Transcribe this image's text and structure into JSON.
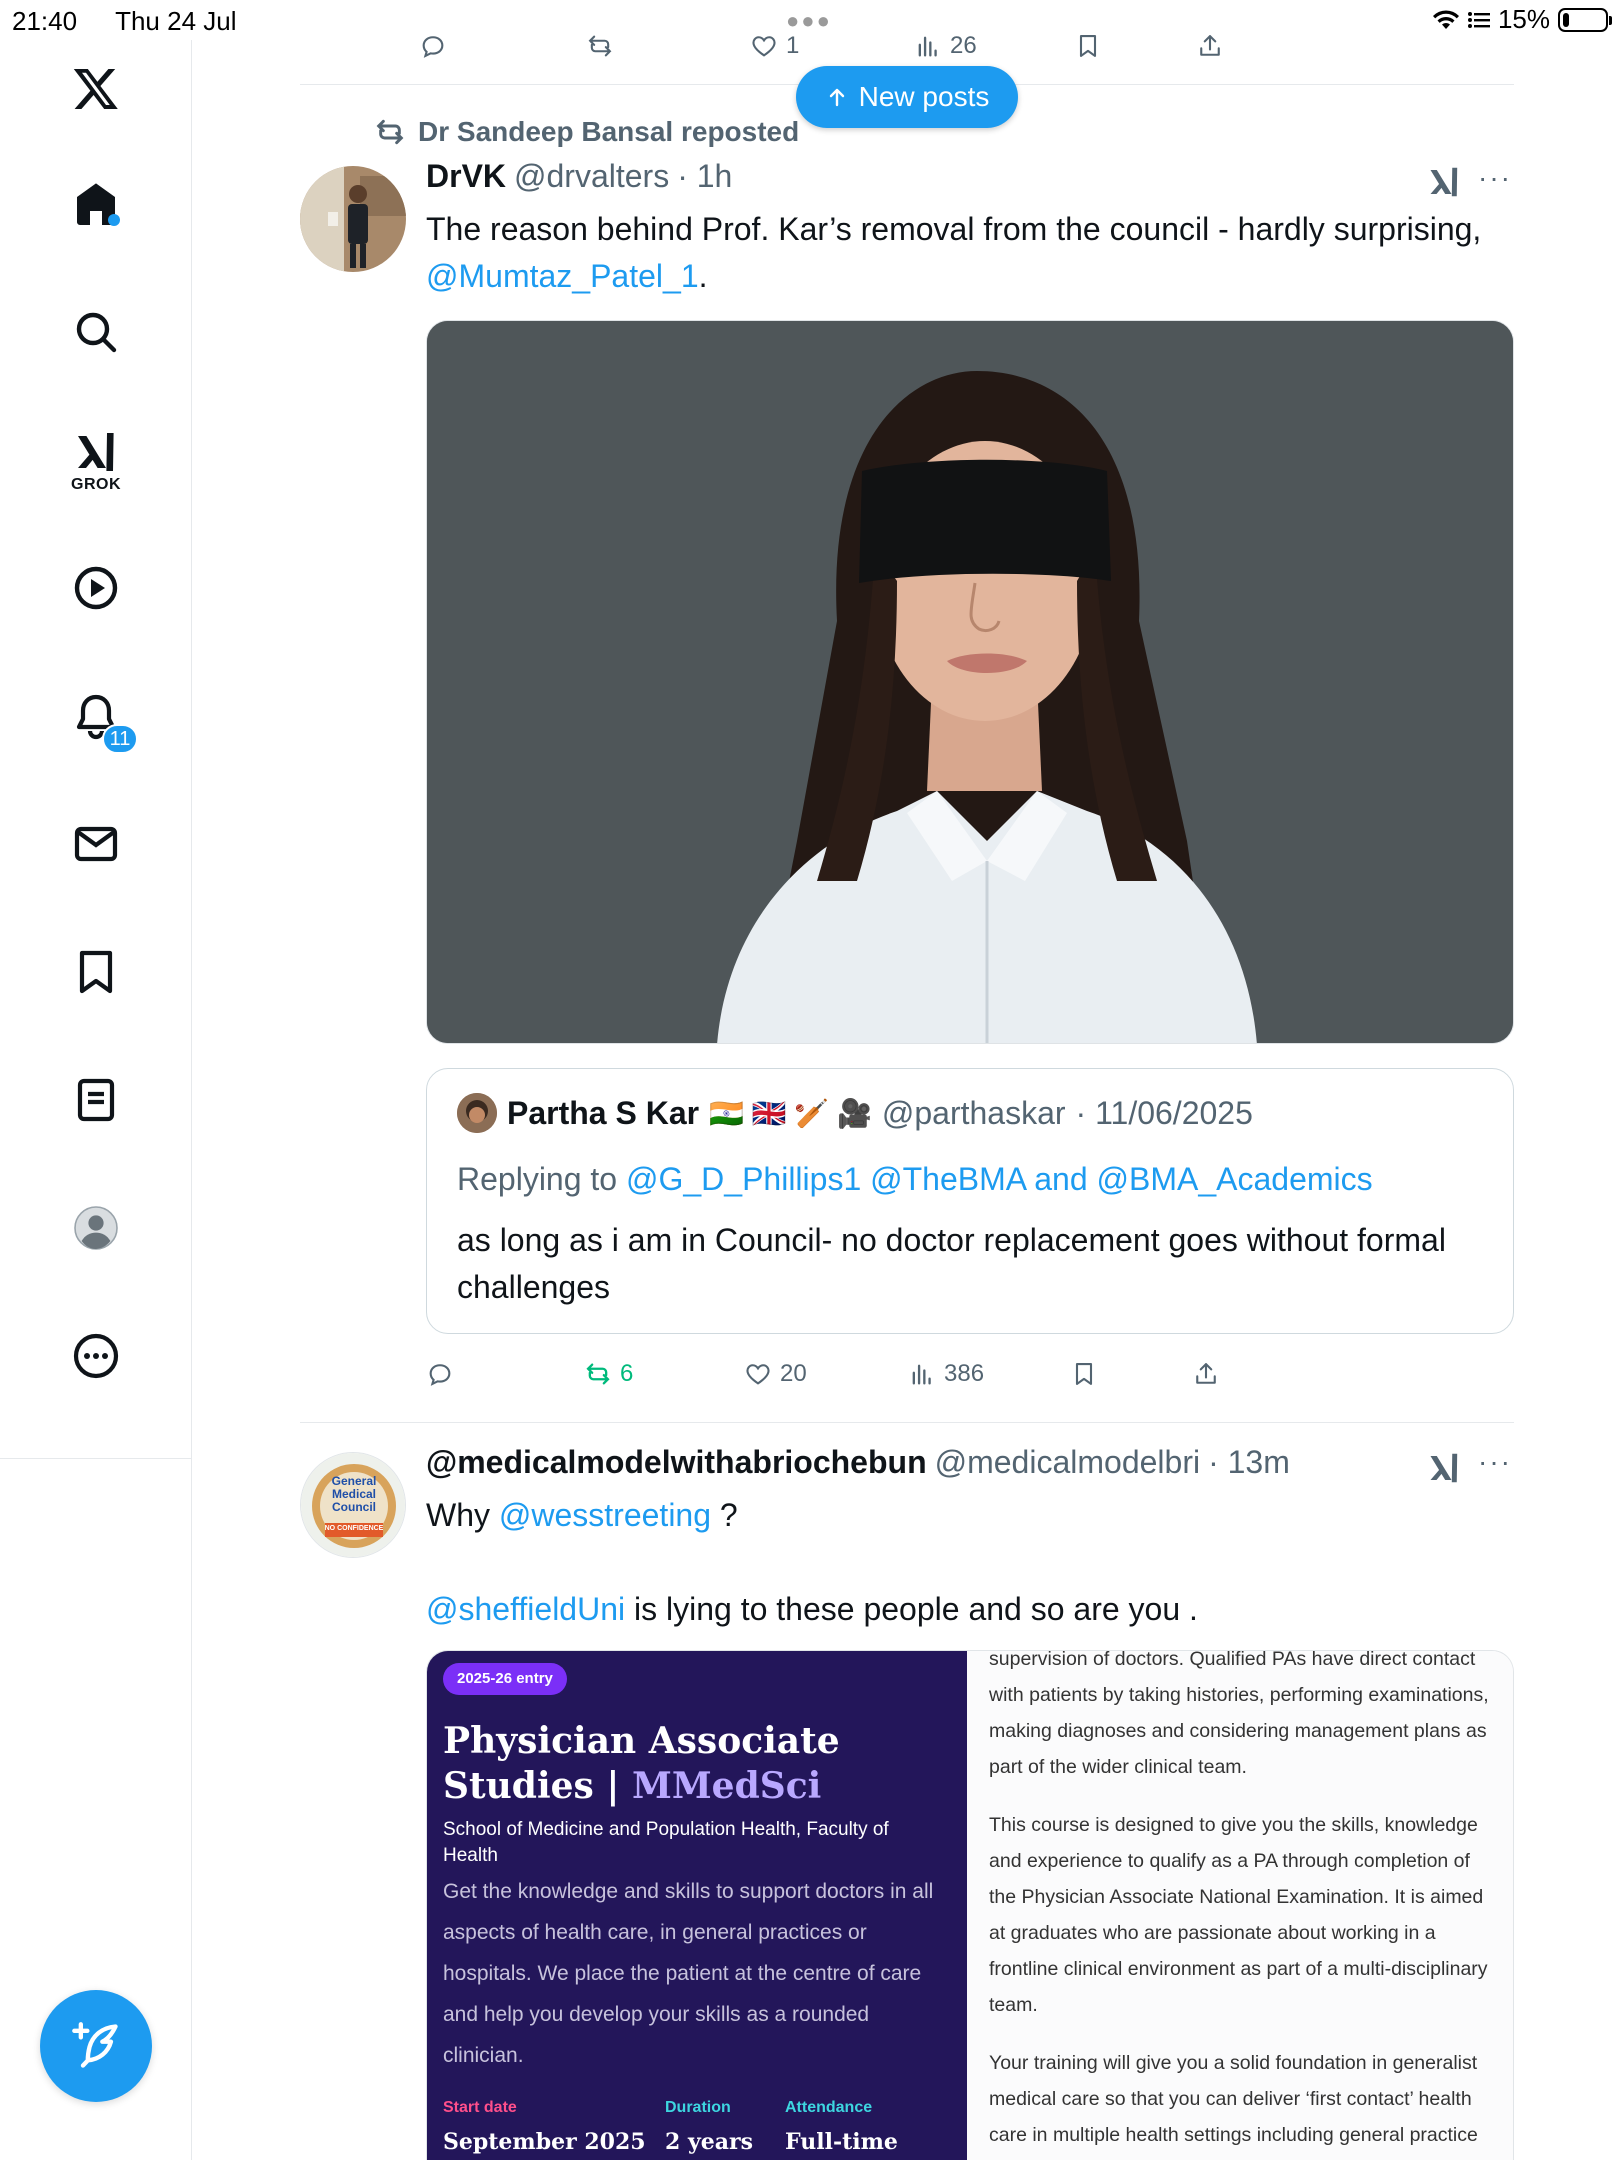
{
  "status_bar": {
    "time": "21:40",
    "date": "Thu 24 Jul",
    "battery": "15%",
    "battery_level": 0.15
  },
  "sidebar": {
    "items": [
      {
        "name": "home",
        "icon": "home-icon"
      },
      {
        "name": "search",
        "icon": "search-icon"
      },
      {
        "name": "grok",
        "icon": "grok-icon",
        "label": "GROK"
      },
      {
        "name": "videos",
        "icon": "play-icon"
      },
      {
        "name": "notifications",
        "icon": "bell-icon",
        "badge": "11"
      },
      {
        "name": "messages",
        "icon": "mail-icon"
      },
      {
        "name": "bookmarks",
        "icon": "bookmark-icon"
      },
      {
        "name": "lists",
        "icon": "list-icon"
      },
      {
        "name": "profile",
        "icon": "profile-icon"
      },
      {
        "name": "more",
        "icon": "more-icon"
      }
    ],
    "compose_icon": "feather-plus-icon"
  },
  "top_actions": {
    "likes": "1",
    "views": "26"
  },
  "new_posts_label": "New posts",
  "post1": {
    "repost_by": "Dr Sandeep Bansal reposted",
    "name": "DrVK",
    "handle": "@drvalters",
    "time": "· 1h",
    "text_before": "The reason behind Prof. Kar’s removal from the council - hardly surprising, ",
    "mention": "@Mumtaz_Patel_1",
    "text_after": ".",
    "quote": {
      "name": "Partha S Kar",
      "emojis": "🇮🇳 🇬🇧 🏏 🎥",
      "handle": "@parthaskar",
      "date": "· 11/06/2025",
      "replying_prefix": "Replying to ",
      "replying_handles": "@G_D_Phillips1 @TheBMA and @BMA_Academics",
      "text": "as long as i am in Council- no doctor replacement goes without formal challenges"
    },
    "stats": {
      "reposts": "6",
      "likes": "20",
      "views": "386"
    }
  },
  "post2": {
    "name": "@medicalmodelwithabriochebun",
    "handle": "@medicalmodelbri",
    "time": "· 13m",
    "avatar_text": "General Medical Council",
    "avatar_subtext": "NO CONFIDENCE",
    "line1_before": "Why ",
    "line1_mention": "@wesstreeting",
    "line1_after": " ?",
    "line2_mention": "@sheffieldUni",
    "line2_after": " is lying to these people and so are you .",
    "card": {
      "pill": "2025-26 entry",
      "title_main": "Physician Associate Studies | ",
      "title_accent": "MMedSci",
      "school": "School of Medicine and Population Health, Faculty of Health",
      "description": "Get the knowledge and skills to support doctors in all aspects of health care, in general practices or hospitals. We place the patient at the centre of care and help you develop your skills as a rounded clinician.",
      "start_label": "Start date",
      "start_value": "September 2025",
      "duration_label": "Duration",
      "duration_value": "2 years",
      "attendance_label": "Attendance",
      "attendance_value": "Full-time",
      "right_p1": "supervision of doctors. Qualified PAs have direct contact with patients by taking histories, performing examinations, making diagnoses and considering management plans as part of the wider clinical team.",
      "right_p2": "This course is designed to give you the skills, knowledge and experience to qualify as a PA through completion of the Physician Associate National Examination. It is aimed at graduates who are passionate about working in a frontline clinical environment as part of a multi-disciplinary team.",
      "right_p3": "Your training will give you a solid foundation in generalist medical care so that you can deliver ‘first contact’ health care in multiple health settings including general practice"
    }
  },
  "colors": {
    "accent": "#1d9bf0",
    "repost_green": "#00ba7c",
    "muted": "#536471",
    "card_bg": "#23165a",
    "card_pill": "#7b2ff7",
    "card_label": "#ff4f8b",
    "card_label_alt": "#3dd6e0"
  }
}
